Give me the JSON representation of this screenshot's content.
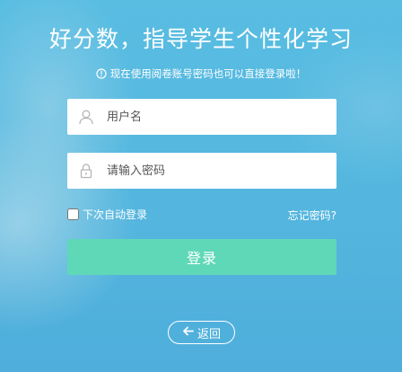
{
  "header": {
    "title": "好分数，指导学生个性化学习",
    "notice": "现在使用阅卷账号密码也可以直接登录啦！",
    "notice_icon": "info-circle-icon"
  },
  "form": {
    "username": {
      "placeholder": "用户名",
      "value": "",
      "icon": "user-icon"
    },
    "password": {
      "placeholder": "请输入密码",
      "value": "",
      "icon": "lock-icon"
    },
    "remember_label": "下次自动登录",
    "remember_checked": false,
    "forgot_label": "忘记密码?",
    "login_label": "登录"
  },
  "footer": {
    "back_label": "返回",
    "back_icon": "arrow-left-icon"
  },
  "colors": {
    "background": "#5bbbe0",
    "login_button": "#5fd8b8",
    "text": "#ffffff"
  }
}
